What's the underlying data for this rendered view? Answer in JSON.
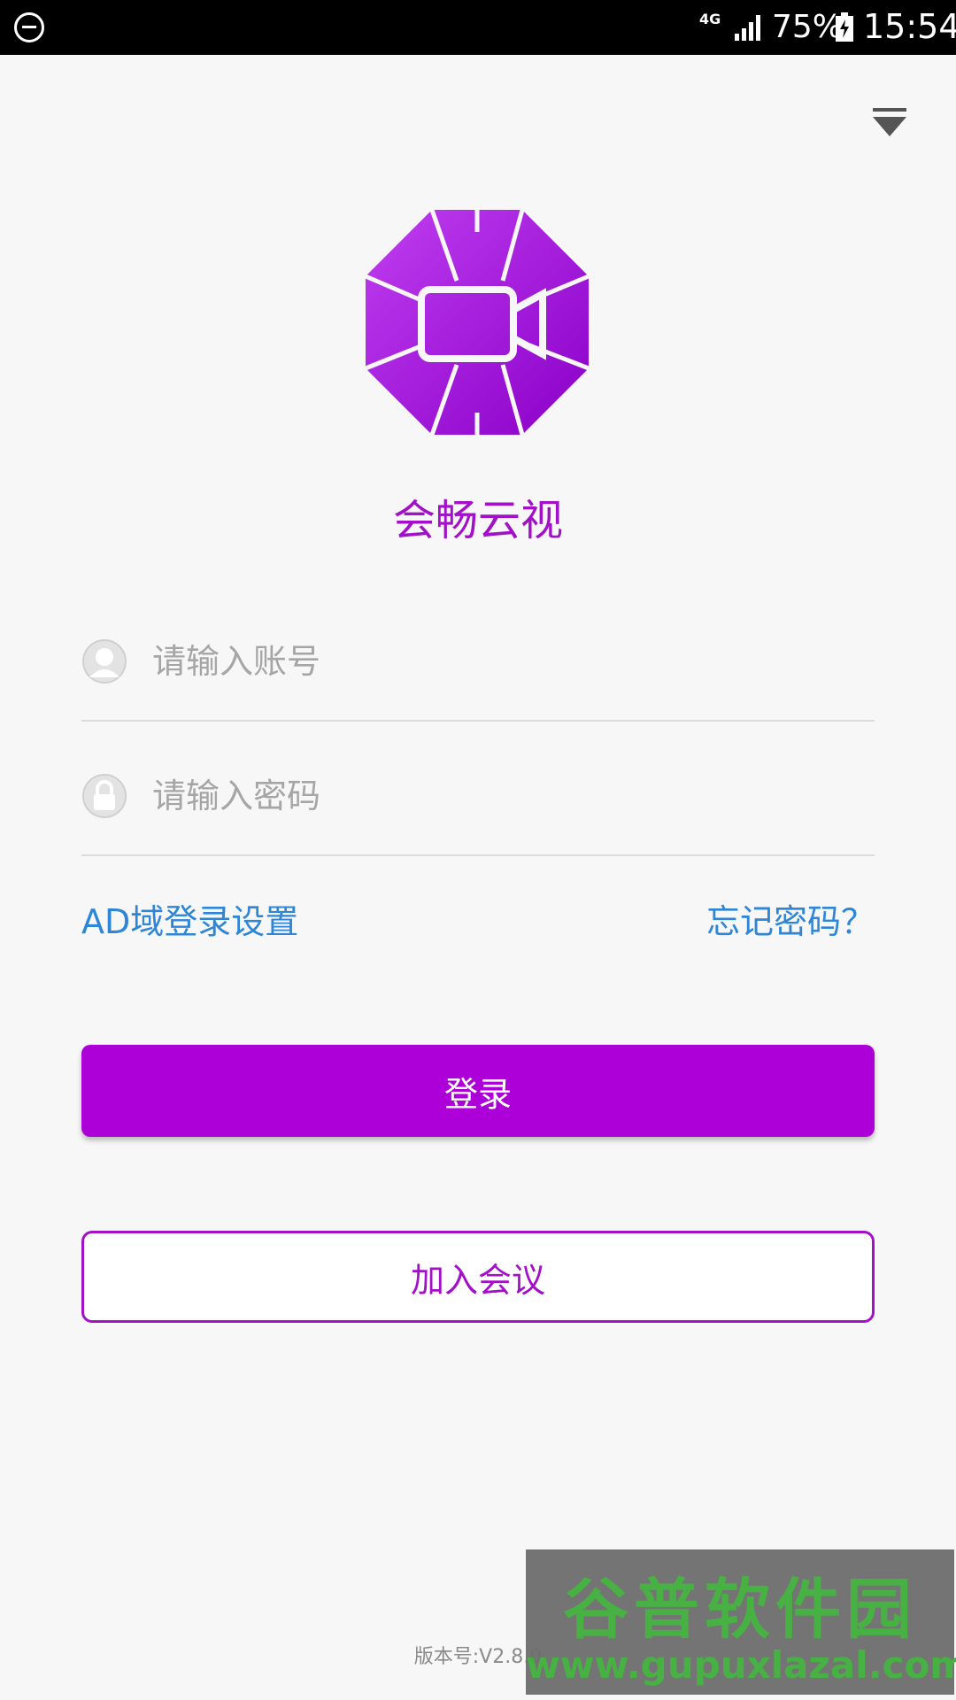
{
  "status_bar": {
    "network": "4G",
    "battery": "75%",
    "time": "15:54",
    "icons": [
      "do-not-disturb-icon",
      "signal-icon",
      "battery-charging-icon"
    ]
  },
  "header": {
    "menu_icon": "dropdown-triangle-icon"
  },
  "app": {
    "logo_icon": "video-camera-octagon-logo",
    "title": "会畅云视",
    "brand_color": "#a210c8"
  },
  "form": {
    "account": {
      "placeholder": "请输入账号",
      "value": "",
      "icon": "user-avatar-icon"
    },
    "password": {
      "placeholder": "请输入密码",
      "value": "",
      "icon": "lock-icon"
    }
  },
  "links": {
    "ad_settings": "AD域登录设置",
    "forgot_password": "忘记密码？",
    "link_color": "#2f86d6"
  },
  "buttons": {
    "login": "登录",
    "join_meeting": "加入会议"
  },
  "footer": {
    "version": "版本号:V2.8.0"
  },
  "watermark": {
    "title": "谷普软件园",
    "url": "www.gupuxlazal.com"
  }
}
